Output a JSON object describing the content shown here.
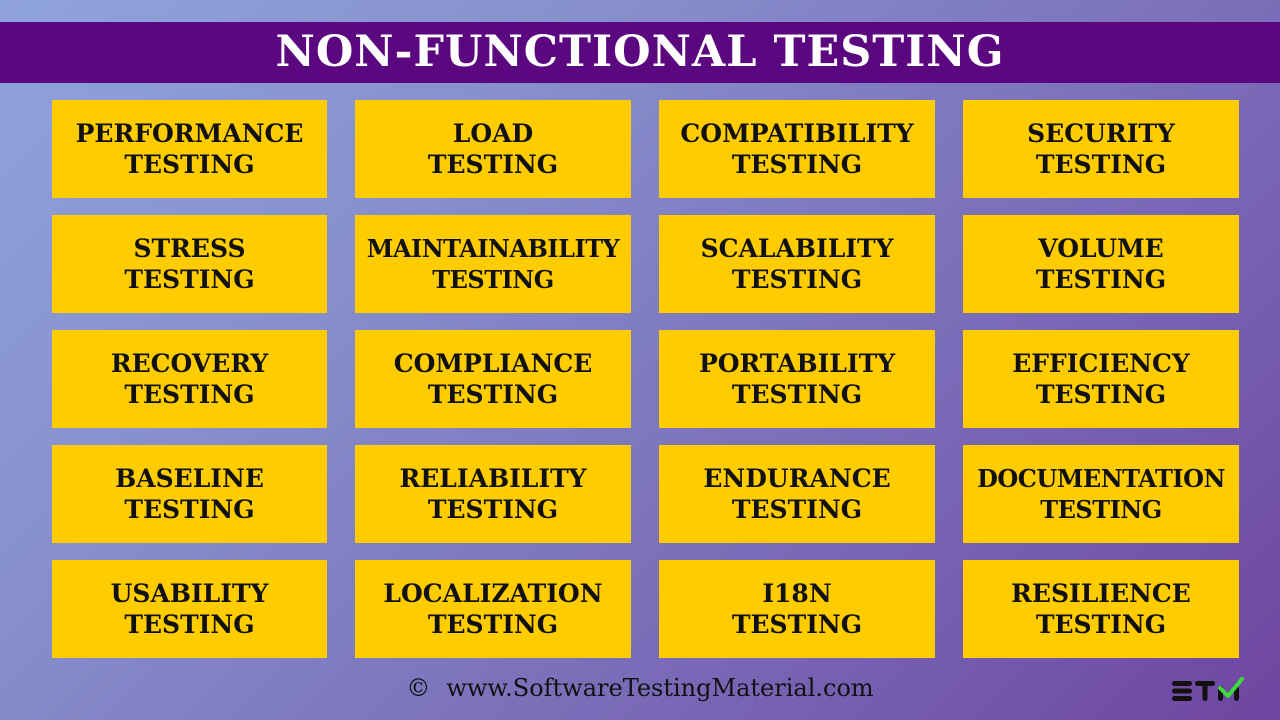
{
  "title": "NON-FUNCTIONAL TESTING",
  "colors": {
    "title_bar": "#5a0780",
    "card": "#ffcc00",
    "card_text": "#111111",
    "logo_check": "#3ddc3d"
  },
  "cards": [
    {
      "line1": "PERFORMANCE",
      "line2": "TESTING"
    },
    {
      "line1": "LOAD",
      "line2": "TESTING"
    },
    {
      "line1": "COMPATIBILITY",
      "line2": "TESTING"
    },
    {
      "line1": "SECURITY",
      "line2": "TESTING"
    },
    {
      "line1": "STRESS",
      "line2": "TESTING"
    },
    {
      "line1": "MAINTAINABILITY",
      "line2": "TESTING"
    },
    {
      "line1": "SCALABILITY",
      "line2": "TESTING"
    },
    {
      "line1": "VOLUME",
      "line2": "TESTING"
    },
    {
      "line1": "RECOVERY",
      "line2": "TESTING"
    },
    {
      "line1": "COMPLIANCE",
      "line2": "TESTING"
    },
    {
      "line1": "PORTABILITY",
      "line2": "TESTING"
    },
    {
      "line1": "EFFICIENCY",
      "line2": "TESTING"
    },
    {
      "line1": "BASELINE",
      "line2": "TESTING"
    },
    {
      "line1": "RELIABILITY",
      "line2": "TESTING"
    },
    {
      "line1": "ENDURANCE",
      "line2": "TESTING"
    },
    {
      "line1": "DOCUMENTATION",
      "line2": "TESTING"
    },
    {
      "line1": "USABILITY",
      "line2": "TESTING"
    },
    {
      "line1": "LOCALIZATION",
      "line2": "TESTING"
    },
    {
      "line1": "I18N",
      "line2": "TESTING"
    },
    {
      "line1": "RESILIENCE",
      "line2": "TESTING"
    }
  ],
  "footer": {
    "copyright_symbol": "©",
    "website": "www.SoftwareTestingMaterial.com"
  },
  "logo": {
    "text": "STM",
    "icon": "checkmark-icon"
  }
}
